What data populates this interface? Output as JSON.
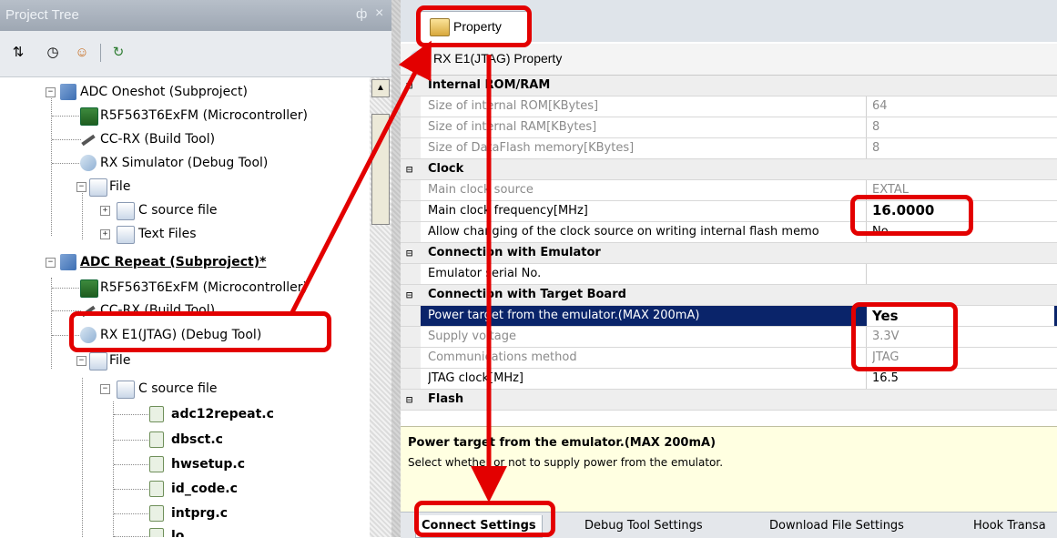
{
  "tree_panel": {
    "title": "Project Tree",
    "pin": "ф",
    "close": "×",
    "toolbar": [
      "sort-icon",
      "properties-icon",
      "user-icon",
      "refresh-icon"
    ],
    "items": [
      {
        "label": "ADC Oneshot (Subproject)",
        "bold": false,
        "underline": false
      },
      {
        "label": "R5F563T6ExFM (Microcontroller)"
      },
      {
        "label": "CC-RX (Build Tool)"
      },
      {
        "label": "RX Simulator (Debug Tool)"
      },
      {
        "label": "File"
      },
      {
        "label": "C source file"
      },
      {
        "label": "Text Files"
      },
      {
        "label": "ADC Repeat (Subproject)*",
        "bold": true,
        "underline": true
      },
      {
        "label": "R5F563T6ExFM (Microcontroller)"
      },
      {
        "label": "CC-RX (Build Tool)"
      },
      {
        "label": "RX E1(JTAG) (Debug Tool)"
      },
      {
        "label": "File"
      },
      {
        "label": "C source file"
      },
      {
        "label": "adc12repeat.c",
        "bold": true
      },
      {
        "label": "dbsct.c",
        "bold": true
      },
      {
        "label": "hwsetup.c",
        "bold": true
      },
      {
        "label": "id_code.c",
        "bold": true
      },
      {
        "label": "intprg.c",
        "bold": true
      },
      {
        "label": "lo...",
        "bold": true
      }
    ]
  },
  "property_panel": {
    "tab_label": "Property",
    "header": "RX E1(JTAG) Property",
    "categories": [
      {
        "name": "Internal ROM/RAM",
        "rows": [
          {
            "name": "Size of internal ROM[KBytes]",
            "value": "64",
            "dim": true
          },
          {
            "name": "Size of internal RAM[KBytes]",
            "value": "8",
            "dim": true
          },
          {
            "name": "Size of DataFlash memory[KBytes]",
            "value": "8",
            "dim": true
          }
        ]
      },
      {
        "name": "Clock",
        "rows": [
          {
            "name": "Main clock source",
            "value": "EXTAL",
            "dim": true
          },
          {
            "name": "Main clock frequency[MHz]",
            "value": "16.0000"
          },
          {
            "name": "Allow changing of the clock source on writing internal flash memo",
            "value": "No"
          }
        ]
      },
      {
        "name": "Connection with Emulator",
        "rows": [
          {
            "name": "Emulator serial No.",
            "value": ""
          }
        ]
      },
      {
        "name": "Connection with Target Board",
        "rows": [
          {
            "name": "Power target from the emulator.(MAX 200mA)",
            "value": "Yes",
            "selected": true
          },
          {
            "name": "Supply voltage",
            "value": "3.3V",
            "dim": true
          },
          {
            "name": "Communications method",
            "value": "JTAG",
            "dim": true
          },
          {
            "name": "JTAG clock[MHz]",
            "value": "16.5"
          }
        ]
      },
      {
        "name": "Flash",
        "rows": []
      }
    ],
    "description": {
      "title": "Power target from the emulator.(MAX 200mA)",
      "text": "Select whether or not to supply power from the emulator."
    },
    "bottom_tabs": [
      "Connect Settings",
      "Debug Tool Settings",
      "Download File Settings",
      "Hook Transa"
    ],
    "expand_glyph": "⊟"
  },
  "colors": {
    "annotation": "#e30000",
    "selection": "#0a246a",
    "description_bg": "#ffffe1"
  }
}
